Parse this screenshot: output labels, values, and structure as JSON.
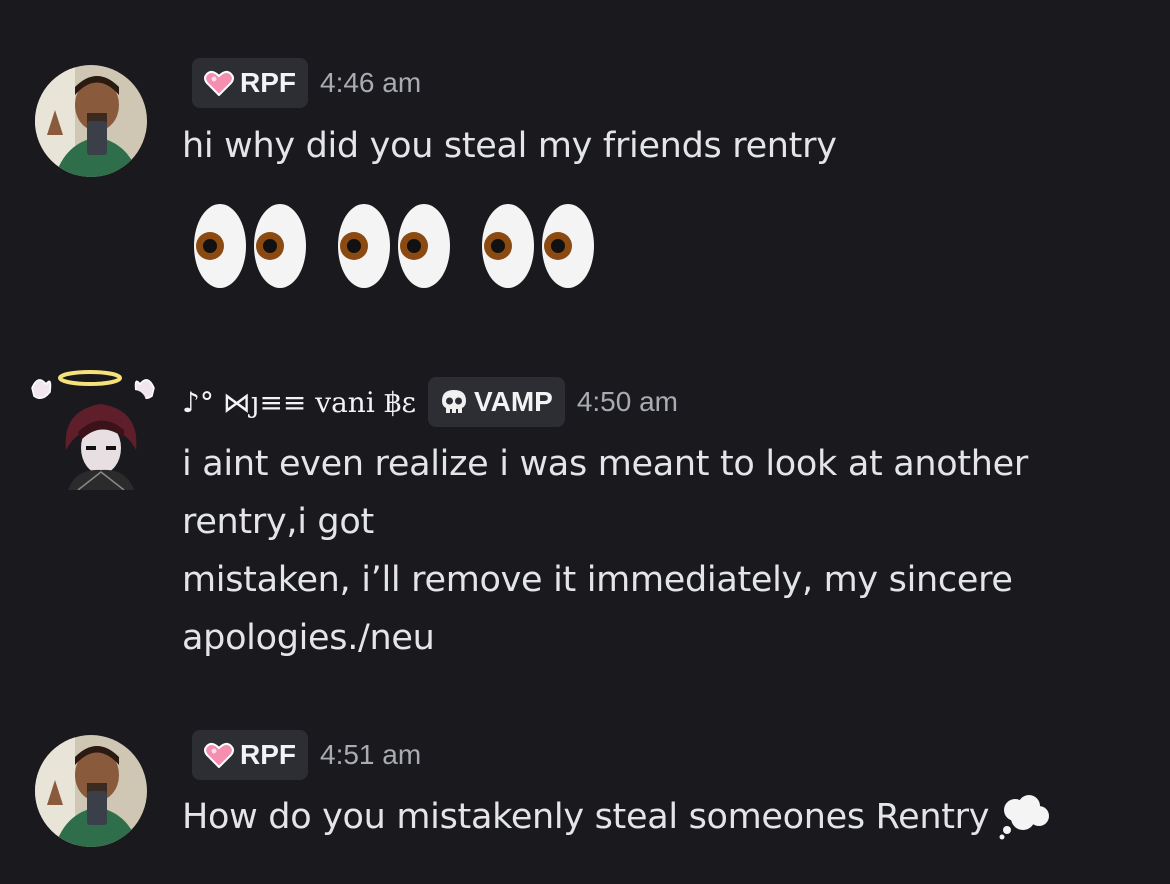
{
  "messages": [
    {
      "author_tag": "RPF",
      "time": "4:46 am",
      "lines": [
        "hi why did you steal my friends rentry"
      ],
      "reaction_emoji": "eyes-icon x3"
    },
    {
      "display_name": "♪° ⋈ȷ≡≡ vani ฿ε",
      "display_name_core": "vani",
      "author_tag": "VAMP",
      "time": "4:50 am",
      "lines": [
        "i aint even realize i was meant to look at another",
        "rentry,i got",
        "mistaken, i’ll remove it immediately, my sincere",
        "apologies./neu"
      ]
    },
    {
      "author_tag": "RPF",
      "time": "4:51 am",
      "lines": [
        "How do you mistakenly steal someones Rentry"
      ],
      "trailing_emoji": "thought-balloon-icon"
    }
  ],
  "colors": {
    "background": "#1a1a1e",
    "tag_bg": "#2d2e33",
    "text": "#e3e5e8",
    "timestamp": "#a8abb2",
    "heart": "#f48fb1"
  }
}
